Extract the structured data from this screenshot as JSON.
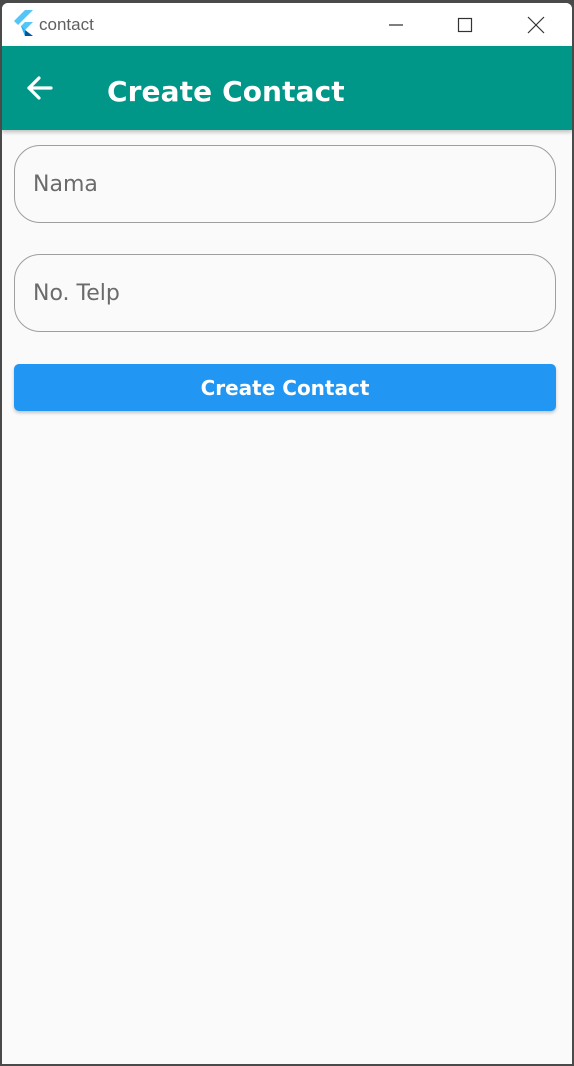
{
  "window": {
    "title": "contact"
  },
  "appbar": {
    "title": "Create Contact",
    "color": "#009688"
  },
  "form": {
    "nama": {
      "placeholder": "Nama",
      "value": ""
    },
    "telp": {
      "placeholder": "No. Telp",
      "value": ""
    },
    "submit_label": "Create Contact",
    "submit_color": "#2196f3"
  },
  "icons": {
    "app": "flutter-logo-icon",
    "back": "arrow-left-icon",
    "minimize": "minimize-icon",
    "maximize": "maximize-icon",
    "close": "close-icon"
  }
}
